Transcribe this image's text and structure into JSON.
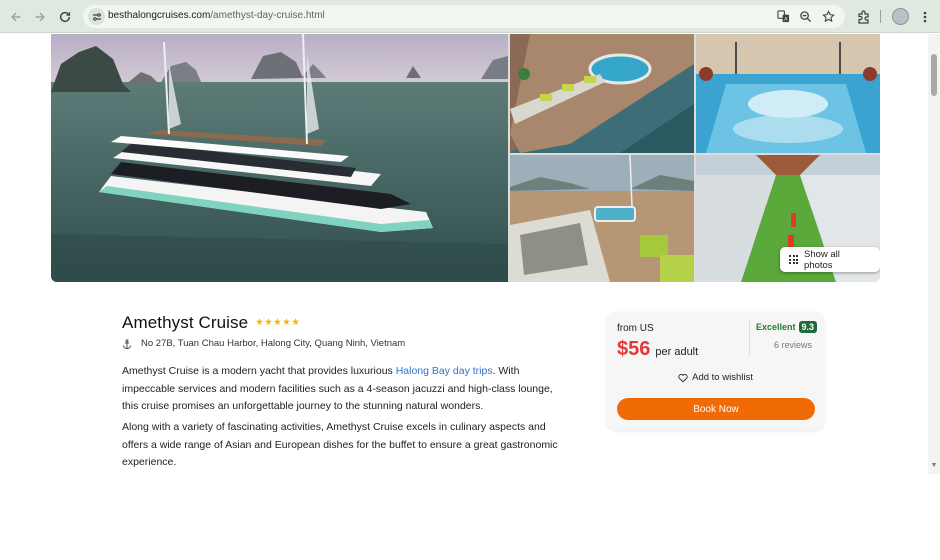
{
  "browser": {
    "url_host": "besthalongcruises.com",
    "url_path": "/amethyst-day-cruise.html",
    "icons": [
      "back-icon",
      "forward-icon",
      "reload-icon",
      "site-info-icon",
      "translate-icon",
      "zoom-icon",
      "bookmark-star-icon",
      "extensions-icon",
      "profile-avatar",
      "menu-icon"
    ]
  },
  "gallery": {
    "show_all_label": "Show all photos"
  },
  "cruise": {
    "name": "Amethyst Cruise",
    "stars": "★★★★★",
    "star_rating": 5,
    "address": "No 27B, Tuan Chau Harbor, Halong City, Quang Ninh, Vietnam",
    "desc1_before": "Amethyst Cruise is a modern yacht that provides luxurious ",
    "desc1_link": "Halong Bay day trips",
    "desc1_after": ". With impeccable services and modern facilities such as a 4-season jacuzzi and high-class lounge, this cruise promises an unforgettable journey to the stunning natural wonders.",
    "desc2": "Along with a variety of fascinating activities, Amethyst Cruise excels in culinary aspects and offers a wide range of Asian and European dishes for the buffet to ensure a great gastronomic experience."
  },
  "booking": {
    "from_label": "from US",
    "price": "$56",
    "per_label": "per adult",
    "rating_word": "Excellent",
    "rating_score": "9.3",
    "reviews": "6 reviews",
    "wishlist_label": "Add to wishlist",
    "book_label": "Book Now"
  },
  "colors": {
    "accent_orange": "#f06a05",
    "price_red": "#e53935",
    "link_blue": "#2f72c8",
    "rating_green": "#1e6b3a",
    "star_yellow": "#f6b400"
  }
}
